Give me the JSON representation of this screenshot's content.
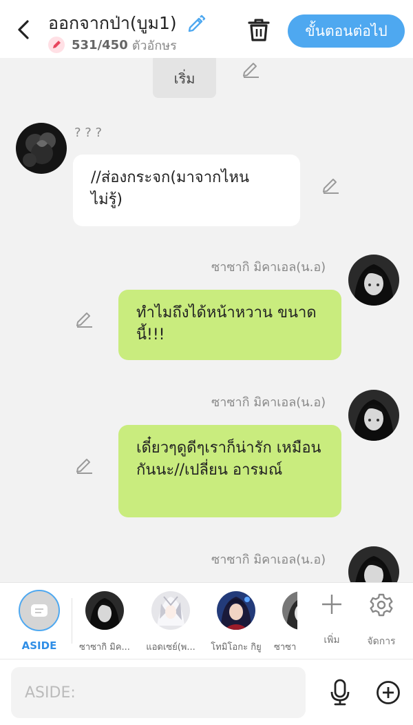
{
  "header": {
    "title": "ออกจากป่า(บูม1)",
    "char_count": "531/450",
    "char_unit": "ตัวอักษร",
    "next_label": "ขั้นตอนต่อไป",
    "accent": "#4ea8f0"
  },
  "chat": {
    "start_label": "เริ่ม",
    "messages": [
      {
        "side": "left",
        "speaker": "? ? ?",
        "text": "//ส่องกระจก(มาจากไหน ไม่รู้)"
      },
      {
        "side": "right",
        "speaker": "ซาซากิ มิคาเอล(น.อ)",
        "text": "ทำไมถึงได้หน้าหวาน ขนาดนี้!!!"
      },
      {
        "side": "right",
        "speaker": "ซาซากิ มิคาเอล(น.อ)",
        "text": "เดี๋ยวๆดูดีๆเราก็น่ารัก เหมือนกันนะ//เปลี่ยน อารมณ์"
      },
      {
        "side": "right",
        "speaker": "ซาซากิ มิคาเอล(น.อ)",
        "text": ""
      }
    ],
    "bubble_colors": {
      "left": "#ffffff",
      "right": "#c9ec7e"
    }
  },
  "charbar": {
    "aside_label": "ASIDE",
    "characters": [
      {
        "name": "ซาซากิ มิค..."
      },
      {
        "name": "แอดเซย์(พ..."
      },
      {
        "name": "โทมิโอกะ กิยู"
      },
      {
        "name": "ซาซา"
      }
    ],
    "add_label": "เพิ่ม",
    "manage_label": "จัดการ"
  },
  "input": {
    "placeholder": "ASIDE:",
    "value": ""
  }
}
